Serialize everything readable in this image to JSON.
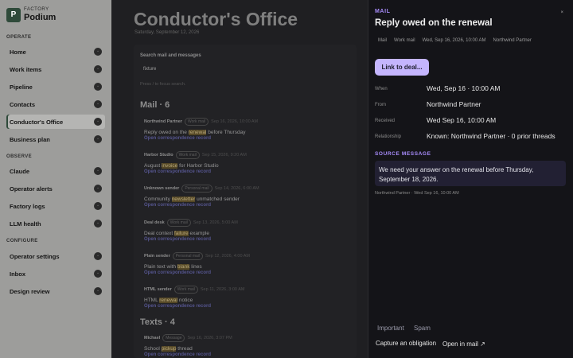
{
  "brand": {
    "kicker": "FACTORY",
    "name": "Podium",
    "logo_letter": "P"
  },
  "sidebar": {
    "sections": {
      "operate": "OPERATE",
      "observe": "OBSERVE",
      "configure": "CONFIGURE"
    },
    "items": [
      {
        "label": "Home",
        "badge": "◦"
      },
      {
        "label": "Work items",
        "badge": "◦"
      },
      {
        "label": "Pipeline",
        "badge": "◦"
      },
      {
        "label": "Contacts",
        "badge": "◦"
      },
      {
        "label": "Conductor's Office",
        "badge": "◦",
        "active": true
      },
      {
        "label": "Business plan",
        "badge": "◦"
      },
      {
        "label": "Claude",
        "badge": "◦"
      },
      {
        "label": "Operator alerts",
        "badge": "◦"
      },
      {
        "label": "Factory logs",
        "badge": "◦"
      },
      {
        "label": "LLM health",
        "badge": "◦"
      },
      {
        "label": "Operator settings",
        "badge": "◦"
      },
      {
        "label": "Inbox",
        "badge": "◦"
      },
      {
        "label": "Design review",
        "badge": "◦"
      }
    ]
  },
  "main": {
    "title": "Conductor's Office",
    "date": "Saturday, September 12, 2026",
    "search": {
      "label": "Search mail and messages",
      "value": "fixture",
      "hint": "Press / to focus search."
    },
    "mail_heading": "Mail · 6",
    "texts_heading": "Texts · 4",
    "link_label": "Open correspondence record",
    "mail": [
      {
        "sender": "Northwind Partner",
        "tag": "Work mail",
        "time": "Sep 16, 2026, 10:00 AM",
        "pre": "Reply owed on the ",
        "hl": "renewal",
        "post": " before Thursday"
      },
      {
        "sender": "Harbor Studio",
        "tag": "Work mail",
        "time": "Sep 15, 2026, 9:20 AM",
        "pre": "August ",
        "hl": "invoice",
        "post": " for Harbor Studio"
      },
      {
        "sender": "Unknown sender",
        "tag": "Personal mail",
        "time": "Sep 14, 2026, 6:00 AM",
        "pre": "Community ",
        "hl": "newsletter",
        "post": " unmatched sender"
      },
      {
        "sender": "Deal desk",
        "tag": "Work mail",
        "time": "Sep 13, 2026, 5:00 AM",
        "pre": "Deal context ",
        "hl": "failure",
        "post": " example"
      },
      {
        "sender": "Plain sender",
        "tag": "Personal mail",
        "time": "Sep 12, 2026, 4:00 AM",
        "pre": "Plain text with ",
        "hl": "blank",
        "post": " lines"
      },
      {
        "sender": "HTML sender",
        "tag": "Work mail",
        "time": "Sep 11, 2026, 3:00 AM",
        "pre": "HTML ",
        "hl": "renewal",
        "post": " notice"
      }
    ],
    "texts": [
      {
        "sender": "Michael",
        "tag": "Message",
        "time": "Sep 16, 2026, 3:07 PM",
        "pre": "School ",
        "hl": "pickup",
        "post": " thread"
      }
    ]
  },
  "drawer": {
    "kicker": "MAIL",
    "title": "Reply owed on the renewal",
    "close": "×",
    "chips": [
      "Mail",
      "Work mail",
      "Wed, Sep 16, 2026, 10:00 AM",
      "Northwind Partner"
    ],
    "link_button": "Link to deal...",
    "fields": [
      {
        "key": "When",
        "value": "Wed, Sep 16 · 10:00 AM"
      },
      {
        "key": "From",
        "value": "Northwind Partner"
      },
      {
        "key": "Received",
        "value": "Wed Sep 16, 10:00 AM"
      },
      {
        "key": "Relationship",
        "value": "Known: Northwind Partner · 0 prior threads"
      }
    ],
    "source_heading": "SOURCE MESSAGE",
    "source_text": "We need your answer on the renewal before Thursday, September 18, 2026.",
    "source_meta": "Northwind Partner · Wed Sep 16, 10:00 AM",
    "important": "Important",
    "spam": "Spam",
    "capture": "Capture an obligation",
    "open_mail": "Open in mail ↗"
  }
}
